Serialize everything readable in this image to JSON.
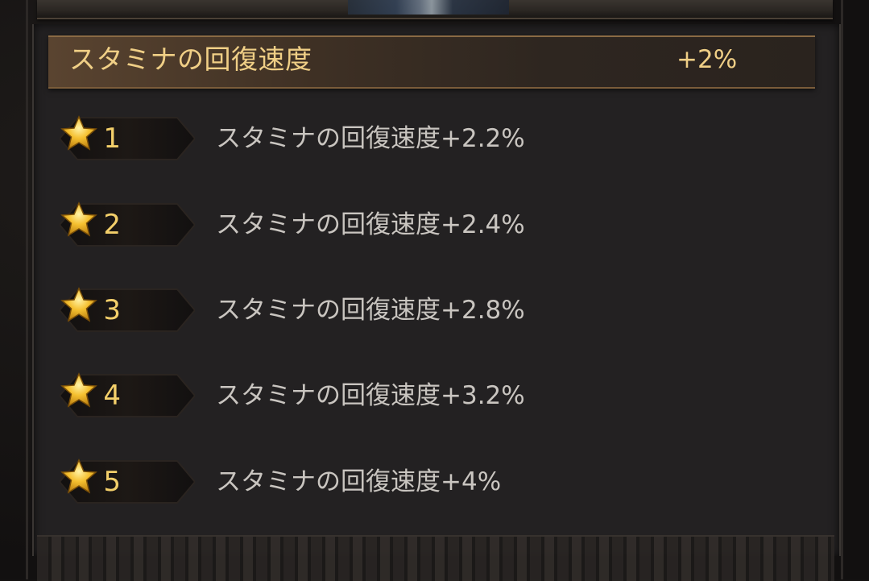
{
  "header": {
    "title": "スタミナの回復速度",
    "value": "+2%"
  },
  "levels": [
    {
      "number": "1",
      "text": "スタミナの回復速度+2.2%"
    },
    {
      "number": "2",
      "text": "スタミナの回復速度+2.4%"
    },
    {
      "number": "3",
      "text": "スタミナの回復速度+2.8%"
    },
    {
      "number": "4",
      "text": "スタミナの回復速度+3.2%"
    },
    {
      "number": "5",
      "text": "スタミナの回復速度+4%"
    }
  ],
  "icons": {
    "level_star": "star-icon"
  },
  "colors": {
    "gold_text": "#f0cf86",
    "body_text": "#c9c5c0",
    "star_gold": "#f5c030",
    "panel_bg": "#232122"
  }
}
